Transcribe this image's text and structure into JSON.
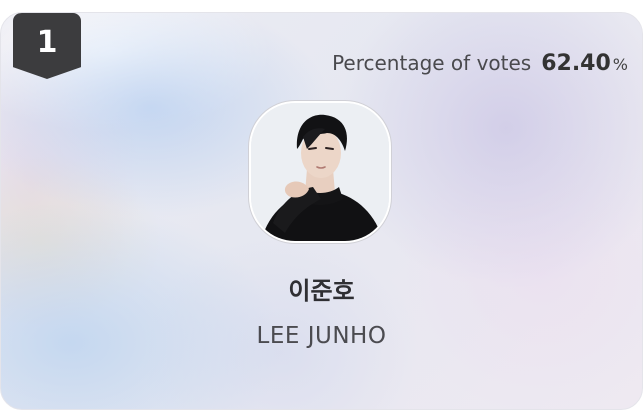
{
  "rank": {
    "number": "1"
  },
  "votes": {
    "label": "Percentage of votes",
    "value": "62.40",
    "unit": "%"
  },
  "artist": {
    "name_korean": "이준호",
    "name_english": "LEE JUNHO"
  }
}
